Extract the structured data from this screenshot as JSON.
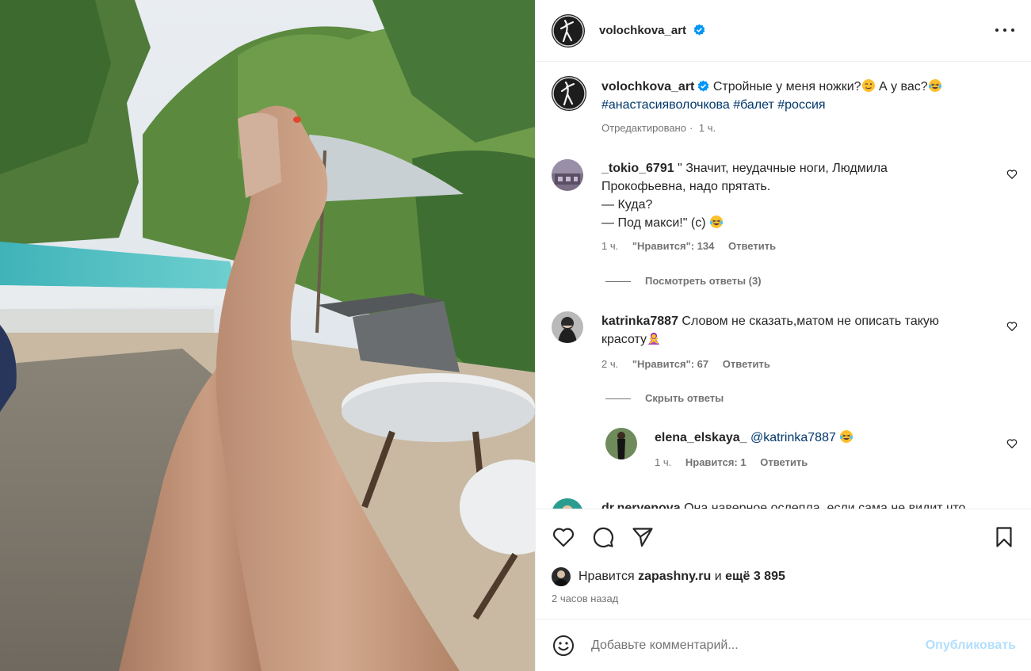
{
  "post": {
    "author": "volochkova_art",
    "author_avatar_icon": "avatar-ballet-pose",
    "verified_icon": "verified-badge-icon",
    "more_icon": "more-options-icon"
  },
  "caption": {
    "author": "volochkova_art",
    "text": "Стройные у меня ножки?",
    "text2": " А у вас?",
    "hashtags": "#анастасияволочкова #балет #россия",
    "edited": "Отредактировано",
    "time": "1 ч."
  },
  "comments": [
    {
      "user": "_tokio_6791",
      "lines": [
        "\" Значит, неудачные ноги, Людмила",
        "Прокофьевна, надо прятать.",
        "— Куда?",
        "— Под макси!\" (с)"
      ],
      "time": "1 ч.",
      "likes": "\"Нравится\": 134",
      "reply": "Ответить",
      "view_replies": "Посмотреть ответы (3)"
    },
    {
      "user": "katrinka7887",
      "lines": [
        "Словом не сказать,матом не описать такую",
        "красоту"
      ],
      "time": "2 ч.",
      "likes": "\"Нравится\": 67",
      "reply": "Ответить",
      "hide_replies": "Скрыть ответы"
    },
    {
      "user": "elena_elskaya_",
      "mention": "@katrinka7887",
      "time": "1 ч.",
      "likes": "Нравится: 1",
      "reply": "Ответить"
    },
    {
      "user": "dr.nervenova",
      "text": "Она наверное ослепла, если сама не видит что"
    }
  ],
  "actions": {
    "like_icon": "heart-icon",
    "comment_icon": "comment-icon",
    "share_icon": "send-icon",
    "save_icon": "bookmark-icon"
  },
  "likes": {
    "prefix": "Нравится",
    "user": "zapashny.ru",
    "middle": "и",
    "rest": "ещё 3 895"
  },
  "posted": "2 часов назад",
  "add_comment": {
    "placeholder": "Добавьте комментарий...",
    "publish": "Опубликовать",
    "emoji_icon": "emoji-icon"
  },
  "colors": {
    "link": "#00376b",
    "verified": "#0095f6",
    "publish_disabled": "#b2dffc",
    "meta": "#737373"
  }
}
